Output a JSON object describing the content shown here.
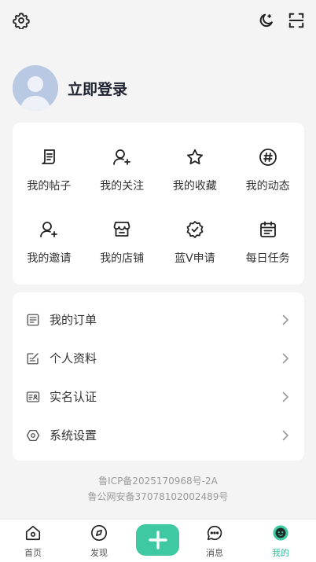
{
  "header": {
    "settings_icon": "gear-icon",
    "theme_icon": "moon-icon",
    "scan_icon": "scan-icon"
  },
  "profile": {
    "login_label": "立即登录",
    "avatar_icon": "user-avatar-placeholder"
  },
  "grid": {
    "items": [
      {
        "label": "我的帖子",
        "icon": "post-icon"
      },
      {
        "label": "我的关注",
        "icon": "user-follow-icon"
      },
      {
        "label": "我的收藏",
        "icon": "star-icon"
      },
      {
        "label": "我的动态",
        "icon": "hashtag-icon"
      },
      {
        "label": "我的邀请",
        "icon": "user-invite-icon"
      },
      {
        "label": "我的店铺",
        "icon": "shop-icon"
      },
      {
        "label": "蓝V申请",
        "icon": "verified-badge-icon"
      },
      {
        "label": "每日任务",
        "icon": "calendar-task-icon"
      }
    ]
  },
  "menu": {
    "items": [
      {
        "label": "我的订单",
        "icon": "order-icon"
      },
      {
        "label": "个人资料",
        "icon": "edit-profile-icon"
      },
      {
        "label": "实名认证",
        "icon": "id-card-icon"
      },
      {
        "label": "系统设置",
        "icon": "hexagon-settings-icon"
      }
    ]
  },
  "footer": {
    "icp": "鲁ICP备2025170968号-2A",
    "police": "鲁公网安备37078102002489号"
  },
  "tabbar": {
    "items": [
      {
        "label": "首页",
        "icon": "home-icon",
        "active": false
      },
      {
        "label": "发现",
        "icon": "compass-icon",
        "active": false
      },
      {
        "label": "消息",
        "icon": "chat-icon",
        "active": false
      },
      {
        "label": "我的",
        "icon": "profile-face-icon",
        "active": true
      }
    ],
    "plus_icon": "plus-icon"
  },
  "colors": {
    "accent": "#3ec9a2",
    "active_tab": "#2fbf9c",
    "background": "#f4f4f4",
    "avatar_bg": "#b9c9e4"
  }
}
